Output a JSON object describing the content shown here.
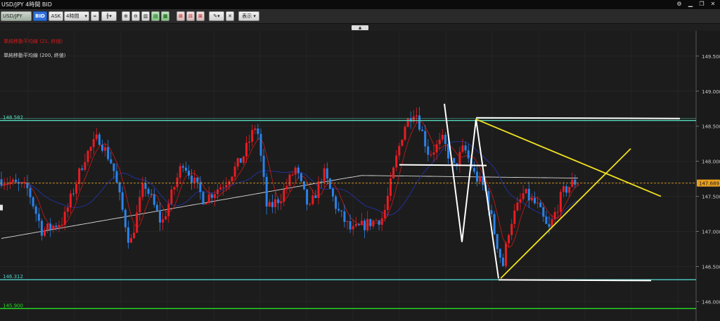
{
  "window": {
    "title": "USD/JPY 4時間 BID"
  },
  "toolbar": {
    "symbol": "USD/JPY",
    "bid_label": "BID",
    "ask_label": "ASK",
    "timeframe": "4時間",
    "display_label": "表示"
  },
  "legend": {
    "ma_short": "単純移動平均線 (21, 終値)",
    "ma_long": "単純移動平均線 (200, 終値)"
  },
  "colors": {
    "bull": "#e81c24",
    "bear": "#2b82e8",
    "ma_short": "#d01a1a",
    "ma_long": "#d8d8d8",
    "ma_mid": "#2233a8",
    "resistance": "#55e0c0",
    "support": "#4fd0c8",
    "low_line": "#22e022",
    "pattern": "#ffffff",
    "triangle": "#f0e020",
    "current": "#e0a020"
  },
  "chart_data": {
    "type": "candlestick",
    "yaxis_ticks": [
      "149.500",
      "149.000",
      "148.500",
      "148.000",
      "147.500",
      "147.000",
      "146.500",
      "146.000"
    ],
    "ylim": [
      145.853,
      149.809
    ],
    "current_price": "147.689",
    "levels": [
      {
        "label": "148.582",
        "value": 148.582
      },
      {
        "label": "146.312",
        "value": 146.312
      },
      {
        "label": "145.900",
        "value": 145.9
      }
    ]
  }
}
